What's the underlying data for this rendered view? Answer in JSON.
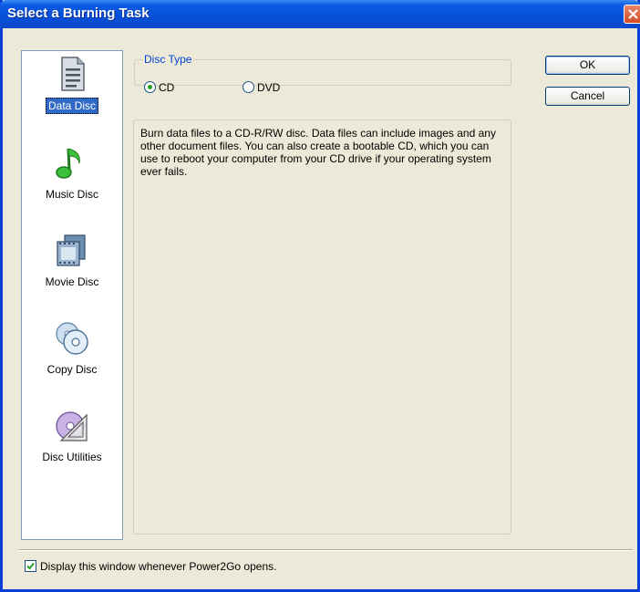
{
  "window": {
    "title": "Select a Burning Task"
  },
  "tasks": [
    {
      "label": "Data Disc",
      "icon": "document-icon",
      "selected": true
    },
    {
      "label": "Music Disc",
      "icon": "music-note-icon",
      "selected": false
    },
    {
      "label": "Movie Disc",
      "icon": "film-icon",
      "selected": false
    },
    {
      "label": "Copy Disc",
      "icon": "copy-disc-icon",
      "selected": false
    },
    {
      "label": "Disc Utilities",
      "icon": "disc-utilities-icon",
      "selected": false
    }
  ],
  "disc_type": {
    "legend": "Disc Type",
    "options": [
      {
        "label": "CD",
        "checked": true
      },
      {
        "label": "DVD",
        "checked": false
      }
    ]
  },
  "description": "Burn data files to a CD-R/RW disc. Data files can include images and any other document files. You can also create a bootable CD, which you can use to reboot your computer from your CD drive if your operating system ever fails.",
  "buttons": {
    "ok": "OK",
    "cancel": "Cancel"
  },
  "footer": {
    "checkbox_label": "Display this window whenever Power2Go opens.",
    "checked": true
  },
  "colors": {
    "titlebar": "#0650d8",
    "accent": "#316ac5",
    "legend": "#0046d5"
  }
}
